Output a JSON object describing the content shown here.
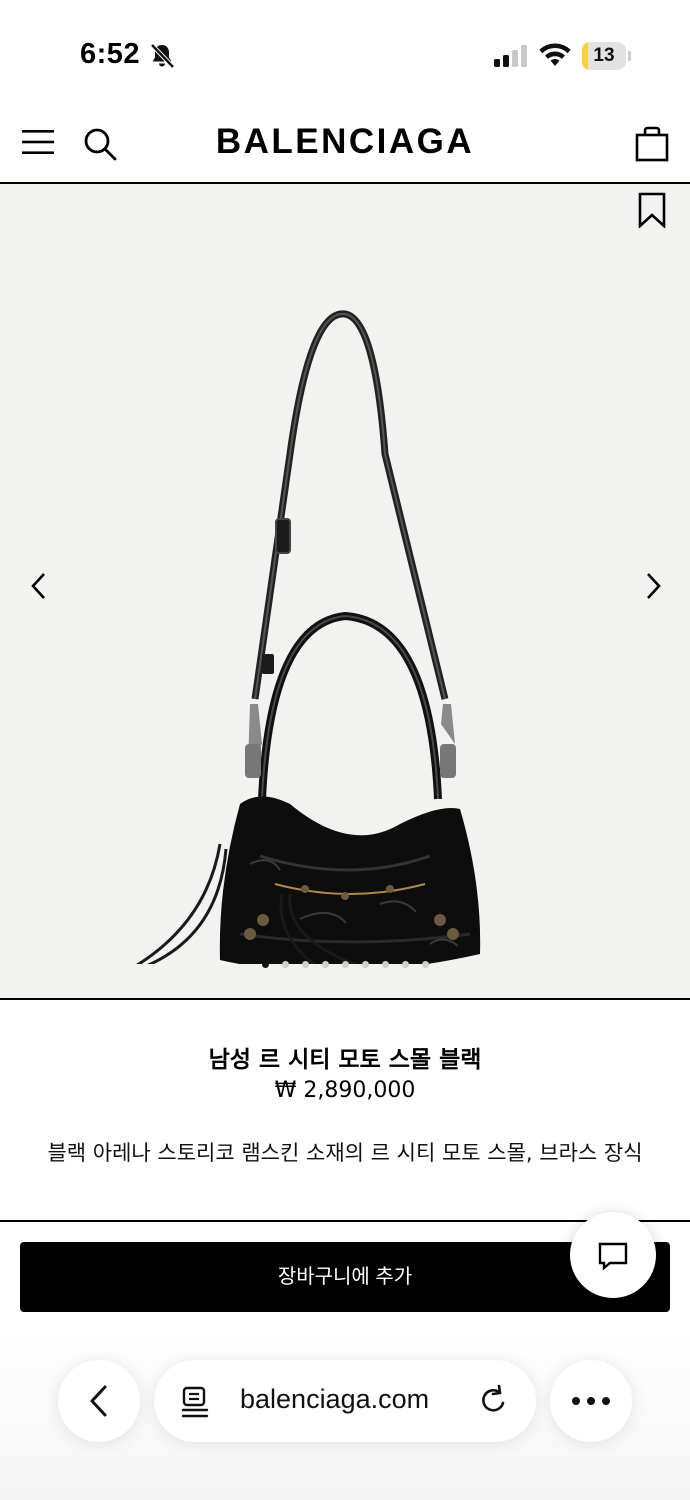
{
  "status_bar": {
    "time": "6:52",
    "battery_level": "13",
    "battery_fraction": 0.13,
    "icons": [
      "bell-slash-icon",
      "cellular-signal-icon",
      "wifi-icon",
      "battery-icon"
    ]
  },
  "header": {
    "brand": "BALENCIAGA",
    "icons": [
      "menu-icon",
      "search-icon",
      "shopping-bag-icon"
    ]
  },
  "gallery": {
    "icons": [
      "bookmark-icon",
      "chevron-left-icon",
      "chevron-right-icon"
    ],
    "image_count": 9,
    "active_index": 0,
    "background": "#f2f2f0"
  },
  "product": {
    "name": "남성 르 시티 모토 스몰 블랙",
    "price": "₩ 2,890,000",
    "description": "블랙 아레나 스토리코 램스킨 소재의 르 시티 모토 스몰, 브라스 장식"
  },
  "actions": {
    "add_to_cart": "장바구니에 추가",
    "chat_icon": "chat-bubble-icon"
  },
  "browser": {
    "url": "balenciaga.com",
    "icons": [
      "chevron-left-icon",
      "reader-mode-icon",
      "reload-icon",
      "more-icon"
    ]
  }
}
